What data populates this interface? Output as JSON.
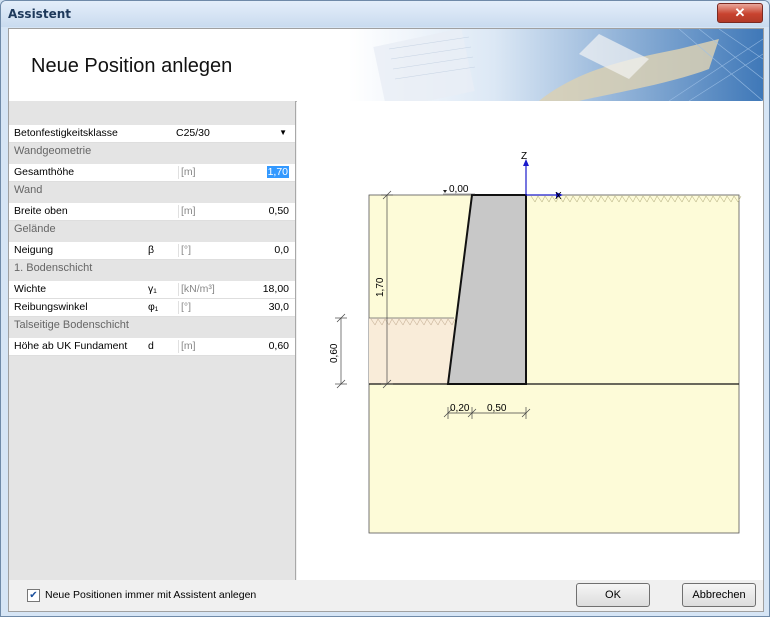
{
  "window": {
    "title": "Assistent",
    "close_glyph": "✕"
  },
  "header": {
    "title": "Neue Position anlegen"
  },
  "properties": [
    {
      "type": "prop",
      "label": "Betonfestigkeitsklasse",
      "combo": "C25/30"
    },
    {
      "type": "cat",
      "label": "Wandgeometrie"
    },
    {
      "type": "prop",
      "label": "Gesamthöhe",
      "symbol": "",
      "unit": "[m]",
      "value": "1,70",
      "selected": true
    },
    {
      "type": "cat",
      "label": "Wand"
    },
    {
      "type": "prop",
      "label": "Breite oben",
      "symbol": "",
      "unit": "[m]",
      "value": "0,50"
    },
    {
      "type": "cat",
      "label": "Gelände"
    },
    {
      "type": "prop",
      "label": "Neigung",
      "symbol": "β",
      "unit": "[°]",
      "value": "0,0"
    },
    {
      "type": "cat",
      "label": "1. Bodenschicht"
    },
    {
      "type": "prop",
      "label": "Wichte",
      "symbol": "γ₁",
      "unit": "[kN/m³]",
      "value": "18,00"
    },
    {
      "type": "prop",
      "label": "Reibungswinkel",
      "symbol": "φ₁",
      "unit": "[°]",
      "value": "30,0"
    },
    {
      "type": "cat",
      "label": "Talseitige Bodenschicht"
    },
    {
      "type": "prop",
      "label": "Höhe ab UK Fundament",
      "symbol": "d",
      "unit": "[m]",
      "value": "0,60"
    }
  ],
  "drawing": {
    "axis_z": "Z",
    "axis_x": "X",
    "level_label": "0,00",
    "dim_height": "1,70",
    "dim_soil": "0,60",
    "dim_base1": "0,20",
    "dim_base2": "0,50",
    "colors": {
      "soil": "#fdfbd8",
      "front_soil": "#f9ecd9",
      "wall": "#c8c8c8",
      "axis": "#1a1acc"
    }
  },
  "footer": {
    "checkbox_label": "Neue Positionen immer mit Assistent anlegen",
    "checkbox_checked": true,
    "check_glyph": "✔",
    "ok_label": "OK",
    "cancel_label": "Abbrechen"
  }
}
